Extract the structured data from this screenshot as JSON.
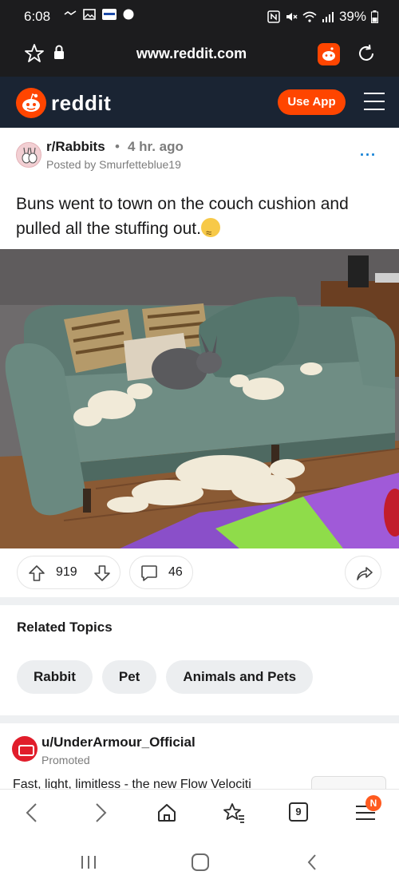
{
  "status_bar": {
    "time": "6:08",
    "battery": "39%"
  },
  "browser": {
    "url": "www.reddit.com"
  },
  "reddit_header": {
    "logo_text": "reddit",
    "use_app_label": "Use App"
  },
  "post": {
    "subreddit": "r/Rabbits",
    "separator": "•",
    "age": "4 hr. ago",
    "posted_by": "Posted by Smurfetteblue19",
    "title": "Buns went to town on the couch cushion and pulled all the stuffing out.",
    "upvotes": "919",
    "comments": "46"
  },
  "related": {
    "title": "Related Topics",
    "chips": [
      "Rabbit",
      "Pet",
      "Animals and Pets"
    ]
  },
  "promoted": {
    "user": "u/UnderArmour_Official",
    "tag": "Promoted",
    "text": "Fast, light, limitless - the new Flow Velociti"
  },
  "browser_nav": {
    "tab_count": "9",
    "notification": "N"
  },
  "icons": {
    "star": "star-icon",
    "lock": "lock-icon",
    "reload": "reload-icon",
    "upvote": "upvote-icon",
    "downvote": "downvote-icon",
    "comment": "comment-icon",
    "share": "share-icon",
    "back": "back-icon",
    "forward": "forward-icon",
    "home": "home-icon",
    "bookmarks": "bookmarks-icon"
  },
  "colors": {
    "reddit_orange": "#ff4500",
    "header_bg": "#1a2433",
    "link_blue": "#0079d3"
  }
}
